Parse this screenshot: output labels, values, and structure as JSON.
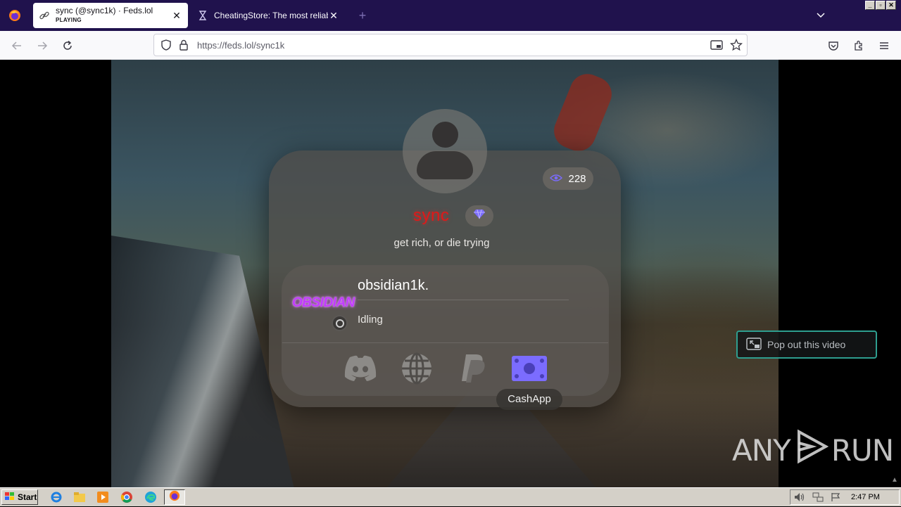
{
  "browser": {
    "tabs": [
      {
        "title": "sync (@sync1k) · Feds.lol",
        "subtitle": "PLAYING",
        "active": true
      },
      {
        "title": "CheatingStore: The most reliable m",
        "active": false
      }
    ],
    "url": "https://feds.lol/sync1k"
  },
  "profile": {
    "username": "sync",
    "username_color": "#e01818",
    "views": "228",
    "bio": "get rich, or die trying",
    "badge_icon": "diamond-icon"
  },
  "discord": {
    "logo_text": "OBSIDIAN",
    "name": "obsidian1k.",
    "status": "Idling"
  },
  "socials": [
    {
      "name": "discord-icon"
    },
    {
      "name": "globe-icon"
    },
    {
      "name": "paypal-icon"
    },
    {
      "name": "cashapp-icon"
    }
  ],
  "tooltip": "CashApp",
  "video": {
    "popout_label": "Pop out this video"
  },
  "watermark": {
    "left": "ANY",
    "right": "RUN"
  },
  "taskbar": {
    "start_label": "Start",
    "time": "2:47 PM"
  },
  "colors": {
    "accent_purple": "#7b6cff",
    "tabbar": "#20124d",
    "popout_border": "#2e9e8f"
  }
}
